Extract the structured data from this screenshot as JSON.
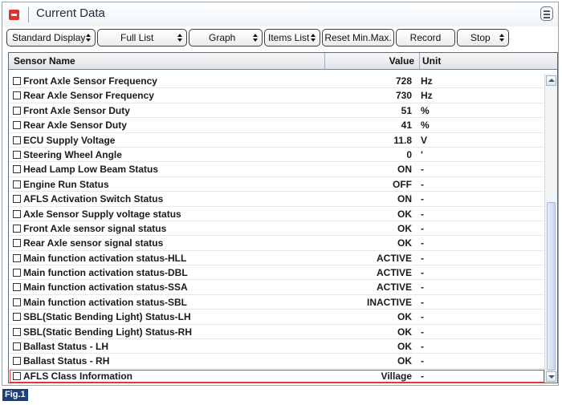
{
  "window": {
    "title": "Current Data",
    "close_icon": "minus-icon",
    "menu_icon": "menu-icon"
  },
  "toolbar": {
    "standard_display": "Standard Display",
    "full_list": "Full List",
    "graph": "Graph",
    "items_list": "Items List",
    "reset_min_max": "Reset Min.Max.",
    "record": "Record",
    "stop": "Stop"
  },
  "table": {
    "columns": {
      "name": "Sensor Name",
      "value": "Value",
      "unit": "Unit"
    },
    "rows": [
      {
        "name": "Front Axle Sensor Frequency",
        "value": "728",
        "unit": "Hz"
      },
      {
        "name": "Rear Axle Sensor Frequency",
        "value": "730",
        "unit": "Hz"
      },
      {
        "name": "Front Axle Sensor Duty",
        "value": "51",
        "unit": "%"
      },
      {
        "name": "Rear Axle Sensor Duty",
        "value": "41",
        "unit": "%"
      },
      {
        "name": "ECU Supply Voltage",
        "value": "11.8",
        "unit": "V"
      },
      {
        "name": "Steering Wheel Angle",
        "value": "0",
        "unit": "'"
      },
      {
        "name": "Head Lamp Low Beam Status",
        "value": "ON",
        "unit": "-"
      },
      {
        "name": "Engine Run Status",
        "value": "OFF",
        "unit": "-"
      },
      {
        "name": "AFLS Activation Switch Status",
        "value": "ON",
        "unit": "-"
      },
      {
        "name": "Axle Sensor Supply voltage status",
        "value": "OK",
        "unit": "-"
      },
      {
        "name": "Front Axle sensor signal status",
        "value": "OK",
        "unit": "-"
      },
      {
        "name": "Rear Axle sensor signal status",
        "value": "OK",
        "unit": "-"
      },
      {
        "name": "Main function activation status-HLL",
        "value": "ACTIVE",
        "unit": "-"
      },
      {
        "name": "Main function activation status-DBL",
        "value": "ACTIVE",
        "unit": "-"
      },
      {
        "name": "Main function activation status-SSA",
        "value": "ACTIVE",
        "unit": "-"
      },
      {
        "name": "Main function activation status-SBL",
        "value": "INACTIVE",
        "unit": "-"
      },
      {
        "name": "SBL(Static Bending Light) Status-LH",
        "value": "OK",
        "unit": "-"
      },
      {
        "name": "SBL(Static Bending Light) Status-RH",
        "value": "OK",
        "unit": "-"
      },
      {
        "name": "Ballast Status - LH",
        "value": "OK",
        "unit": "-"
      },
      {
        "name": "Ballast Status - RH",
        "value": "OK",
        "unit": "-"
      },
      {
        "name": "AFLS Class Information",
        "value": "Village",
        "unit": "-"
      }
    ],
    "highlighted_row": 20,
    "highlight_color": "#e23b3b"
  },
  "figure_label": "Fig.1"
}
